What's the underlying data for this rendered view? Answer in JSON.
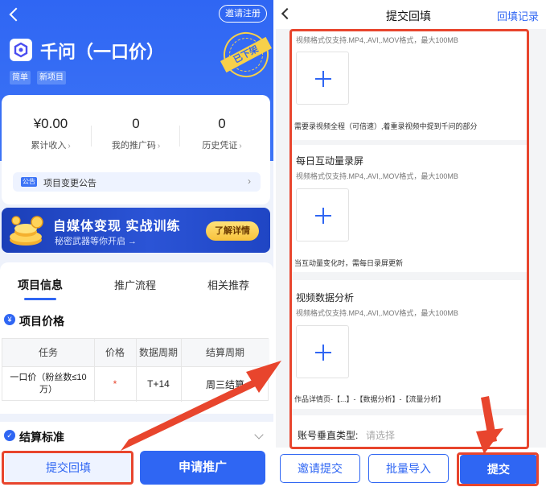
{
  "left": {
    "invite_label": "邀请注册",
    "project_title": "千问（一口价）",
    "tags": [
      "简单",
      "新项目"
    ],
    "stamp_text": "已下架",
    "stats": [
      {
        "value": "¥0.00",
        "label": "累计收入"
      },
      {
        "value": "0",
        "label": "我的推广码"
      },
      {
        "value": "0",
        "label": "历史凭证"
      }
    ],
    "notice": {
      "badge": "公告",
      "text": "项目变更公告"
    },
    "banner": {
      "title": "自媒体变现 实战训练",
      "subtitle": "秘密武器等你开启 →",
      "button": "了解详情"
    },
    "tabs": [
      "项目信息",
      "推广流程",
      "相关推荐"
    ],
    "price_section": {
      "title": "项目价格",
      "columns": [
        "任务",
        "价格",
        "数据周期",
        "结算周期"
      ],
      "rows": [
        {
          "task": "一口价（粉丝数≤10万）",
          "price": "*",
          "data_cycle": "T+14",
          "settle_cycle": "周三结算"
        }
      ]
    },
    "settle_section": {
      "title": "结算标准"
    },
    "bottom": {
      "submit_label": "提交回填",
      "apply_label": "申请推广"
    }
  },
  "right": {
    "title": "提交回填",
    "record_label": "回填记录",
    "sections": [
      {
        "label": "",
        "hint": "视频格式仅支持.MP4,.AVI,.MOV格式，最大100MB",
        "note": "需要录视频全程（可倍速）,着重录视频中提到千问的部分"
      },
      {
        "label": "每日互动量录屏",
        "hint": "视频格式仅支持.MP4,.AVI,.MOV格式，最大100MB",
        "note": "当互动量变化时，需每日录屏更新"
      },
      {
        "label": "视频数据分析",
        "hint": "视频格式仅支持.MP4,.AVI,.MOV格式，最大100MB",
        "note": "作品详情页-【...】-【数据分析】-【流量分析】"
      }
    ],
    "account_type": {
      "label": "账号垂直类型:",
      "placeholder": "请选择"
    },
    "bottom": {
      "invite_label": "邀请提交",
      "import_label": "批量导入",
      "submit_label": "提交"
    }
  },
  "colors": {
    "primary": "#2f66f3",
    "annotation_red": "#e8452d",
    "stamp_yellow": "#f7d04a"
  },
  "icons": [
    "back-icon",
    "app-logo-icon",
    "stamp-icon",
    "notice-icon",
    "coin-icon",
    "yen-icon",
    "check-icon",
    "chevron-down-icon",
    "plus-icon",
    "arrow-annotation-icon"
  ]
}
